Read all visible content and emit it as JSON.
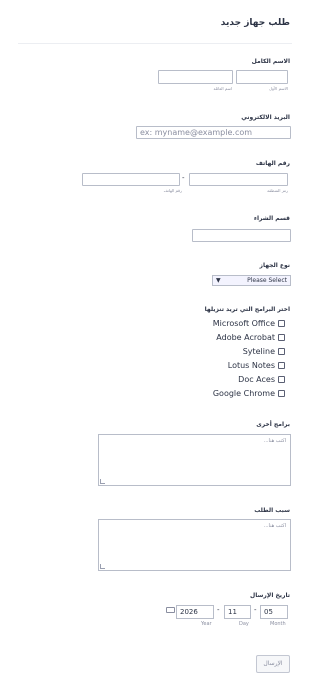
{
  "form": {
    "title": "طلب جهاز جديد",
    "submit_label": "الإرسال"
  },
  "full_name": {
    "label": "الاسم الكامل",
    "first_sublabel": "الاسم الأول",
    "last_sublabel": "اسم العائلة"
  },
  "email": {
    "label": "البريد الالكتروني",
    "placeholder": "ex: myname@example.com"
  },
  "phone": {
    "label": "رقم الهاتف",
    "area_sublabel": "رمز المنطقة",
    "number_sublabel": "رقم الهاتف",
    "separator": "-"
  },
  "department": {
    "label": "قسم الشراء"
  },
  "device_type": {
    "label": "نوع الجهاز",
    "selected": "Please Select"
  },
  "software": {
    "label": "اختر البرامج التي تريد تنزيلها",
    "options": [
      "Microsoft Office",
      "Adobe Acrobat",
      "Syteline",
      "Lotus Notes",
      "Doc Aces",
      "Google Chrome"
    ]
  },
  "other_programs": {
    "label": "برامج أخرى",
    "placeholder": "اكتب هنا..."
  },
  "reason": {
    "label": "سبب الطلب",
    "placeholder": "اكتب هنا..."
  },
  "send_date": {
    "label": "تاريخ الإرسال",
    "year": "2026",
    "day": "11",
    "month": "05",
    "year_label": "Year",
    "day_label": "Day",
    "month_label": "Month",
    "separator": "-"
  }
}
